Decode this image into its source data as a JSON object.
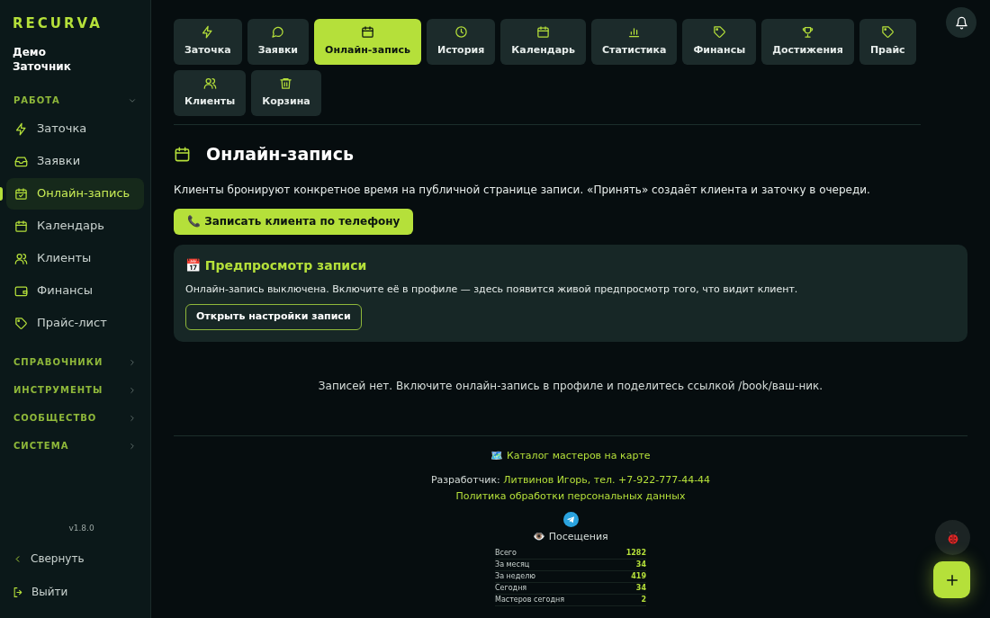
{
  "sidebar": {
    "logo": "RECURVA",
    "user": "Демо Заточник",
    "sections": [
      {
        "title": "РАБОТА",
        "expanded": true,
        "items": [
          {
            "label": "Заточка",
            "selected": false
          },
          {
            "label": "Заявки",
            "selected": false
          },
          {
            "label": "Онлайн-запись",
            "selected": true
          },
          {
            "label": "Календарь",
            "selected": false
          },
          {
            "label": "Клиенты",
            "selected": false
          },
          {
            "label": "Финансы",
            "selected": false
          },
          {
            "label": "Прайс-лист",
            "selected": false
          }
        ]
      },
      {
        "title": "СПРАВОЧНИКИ",
        "expanded": false
      },
      {
        "title": "ИНСТРУМЕНТЫ",
        "expanded": false
      },
      {
        "title": "СООБЩЕСТВО",
        "expanded": false
      },
      {
        "title": "СИСТЕМА",
        "expanded": false
      }
    ],
    "version": "v1.8.0",
    "collapse": "Свернуть",
    "logout": "Выйти"
  },
  "tabs": [
    {
      "label": "Заточка",
      "selected": false
    },
    {
      "label": "Заявки",
      "selected": false
    },
    {
      "label": "Онлайн-запись",
      "selected": true
    },
    {
      "label": "История",
      "selected": false
    },
    {
      "label": "Календарь",
      "selected": false
    },
    {
      "label": "Статистика",
      "selected": false
    },
    {
      "label": "Финансы",
      "selected": false
    },
    {
      "label": "Достижения",
      "selected": false
    },
    {
      "label": "Прайс",
      "selected": false
    },
    {
      "label": "Клиенты",
      "selected": false
    },
    {
      "label": "Корзина",
      "selected": false
    }
  ],
  "page": {
    "title": "Онлайн-запись",
    "description": "Клиенты бронируют конкретное время на публичной странице записи. «Принять» создаёт клиента и заточку в очереди.",
    "phone_button": "📞 Записать клиента по телефону",
    "preview": {
      "title": "📅 Предпросмотр записи",
      "text": "Онлайн-запись выключена. Включите её в профиле — здесь появится живой предпросмотр того, что видит клиент.",
      "button": "Открыть настройки записи"
    },
    "empty": "Записей нет. Включите онлайн-запись в профиле и поделитесь ссылкой /book/ваш-ник."
  },
  "footer": {
    "catalog": "🗺️ Каталог мастеров на карте",
    "developer_label": "Разработчик:",
    "developer": "Литвинов Игорь, тел. +7-922-777-44-44",
    "policy": "Политика обработки персональных данных",
    "visits_title": "👁️ Посещения",
    "visits": [
      {
        "label": "Всего",
        "value": "1282"
      },
      {
        "label": "За месяц",
        "value": "34"
      },
      {
        "label": "За неделю",
        "value": "419"
      },
      {
        "label": "Сегодня",
        "value": "34"
      },
      {
        "label": "Мастеров сегодня",
        "value": "2"
      }
    ]
  }
}
